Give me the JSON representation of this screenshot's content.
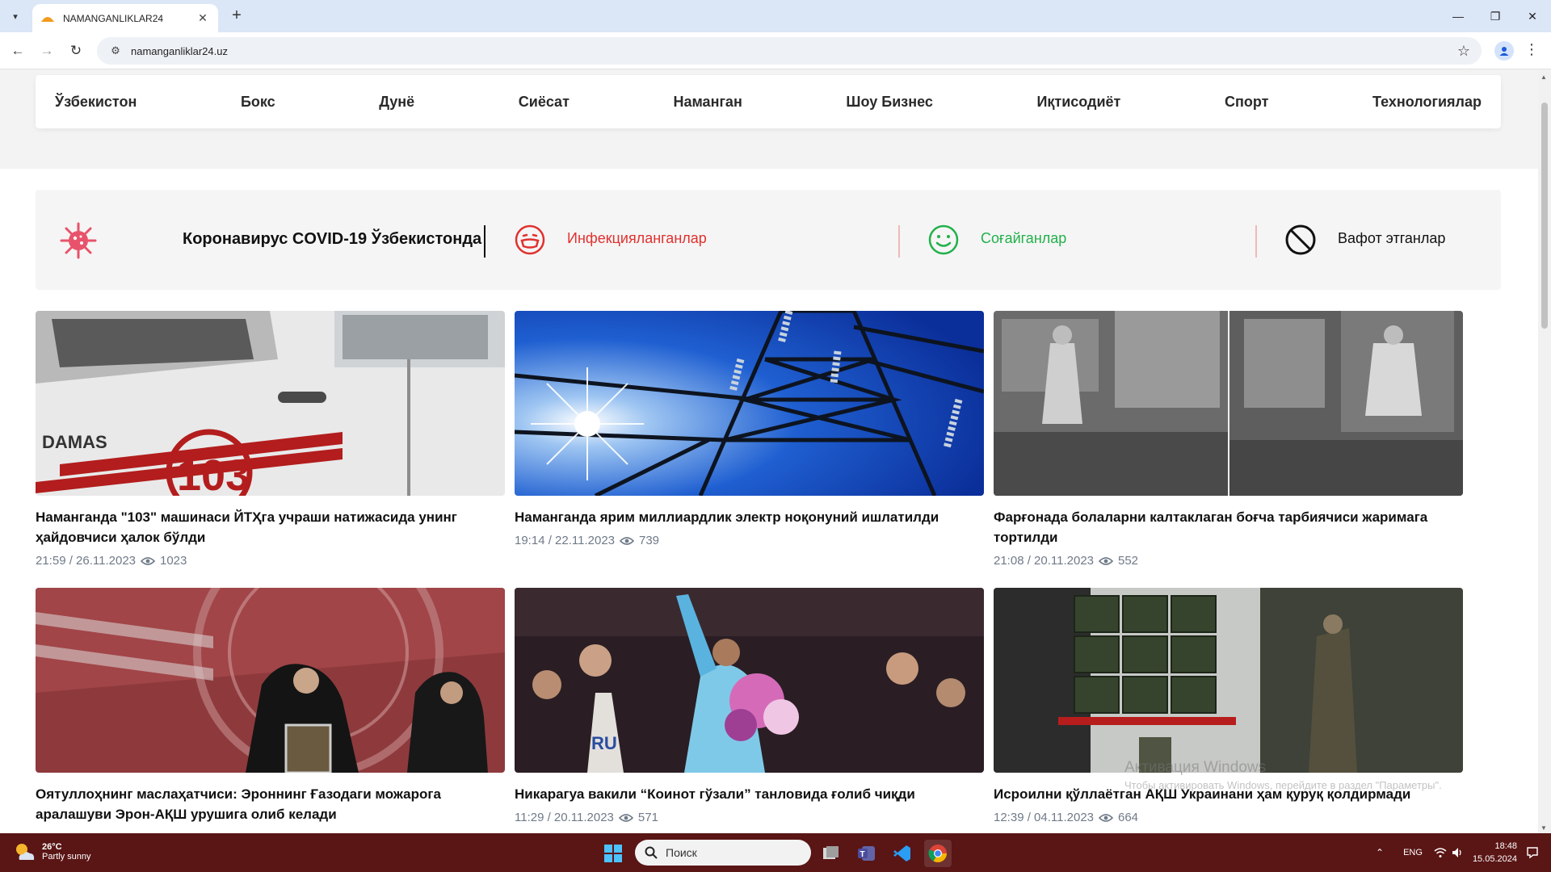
{
  "browser": {
    "tab_title": "NAMANGANLIKLAR24",
    "url": "namanganliklar24.uz",
    "new_tab": "+",
    "close": "✕"
  },
  "nav": {
    "categories": [
      "Ўзбекистон",
      "Бокс",
      "Дунё",
      "Сиёсат",
      "Наманган",
      "Шоу Бизнес",
      "Иқтисодиёт",
      "Спорт",
      "Технологиялар"
    ]
  },
  "covid": {
    "title": "Коронавирус COVID-19 Ўзбекистонда",
    "infected_label": "Инфекцияланганлар",
    "recovered_label": "Соғайганлар",
    "deaths_label": "Вафот этганлар",
    "colors": {
      "infected": "#e0312f",
      "recovered": "#22b04b",
      "deaths": "#111111",
      "accent": "#e8536b"
    }
  },
  "news": [
    {
      "title": "Наманганда \"103\" машинаси ЙТҲга учраши натижасида унинг ҳайдовчиси ҳалок бўлди",
      "date": "21:59 / 26.11.2023",
      "views": "1023"
    },
    {
      "title": "Наманганда ярим миллиардлик электр ноқонуний ишлатилди",
      "date": "19:14 / 22.11.2023",
      "views": "739"
    },
    {
      "title": "Фарғонада болаларни калтаклаган боғча тарбиячиси жаримага тортилди",
      "date": "21:08 / 20.11.2023",
      "views": "552"
    },
    {
      "title": "Оятуллоҳнинг маслаҳатчиси: Эроннинг Ғазодаги можарога аралашуви Эрон-АҚШ урушига олиб келади",
      "date": "",
      "views": ""
    },
    {
      "title": "Никарагуа вакили “Коинот гўзали” танловида ғолиб чиқди",
      "date": "11:29 / 20.11.2023",
      "views": "571"
    },
    {
      "title": "Исроилни қўллаётган АҚШ Украинани ҳам қуруқ қолдирмади",
      "date": "12:39 / 04.11.2023",
      "views": "664"
    }
  ],
  "image_text": {
    "damas": "DAMAS",
    "ambulance_number": "103",
    "sash": "RU"
  },
  "windows": {
    "watermark_title": "Активация Windows",
    "watermark_sub": "Чтобы активировать Windows, перейдите в раздел \"Параметры\".",
    "weather_temp": "26°C",
    "weather_desc": "Partly sunny",
    "search_placeholder": "Поиск",
    "language": "ENG",
    "time": "18:48",
    "date": "15.05.2024"
  }
}
